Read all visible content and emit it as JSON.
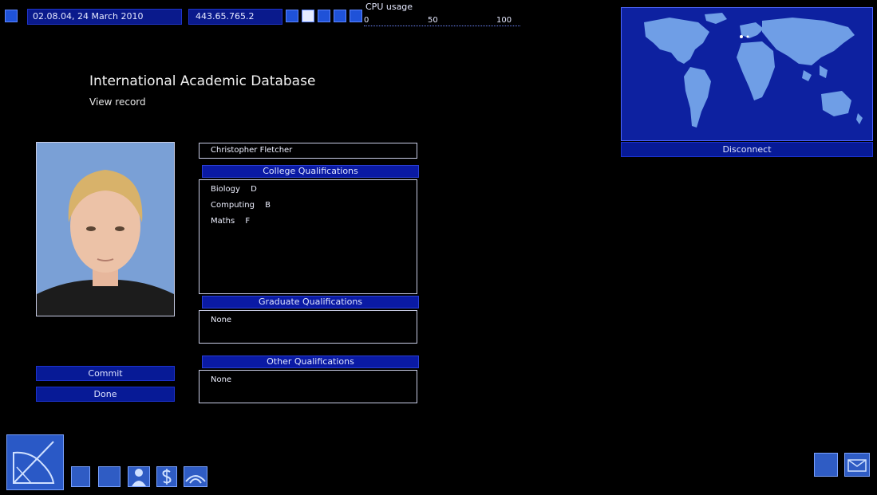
{
  "topbar": {
    "datetime": "02.08.04, 24 March 2010",
    "ip": "443.65.765.2",
    "cpu_label": "CPU usage",
    "cpu_ticks": [
      "0",
      "50",
      "100"
    ]
  },
  "header": {
    "title": "International Academic Database",
    "subtitle": "View record"
  },
  "record": {
    "name": "Christopher Fletcher",
    "college_header": "College Qualifications",
    "college": [
      {
        "subject": "Biology",
        "grade": "D"
      },
      {
        "subject": "Computing",
        "grade": "B"
      },
      {
        "subject": "Maths",
        "grade": "F"
      }
    ],
    "graduate_header": "Graduate Qualifications",
    "graduate": "None",
    "other_header": "Other Qualifications",
    "other": "None"
  },
  "actions": {
    "commit": "Commit",
    "done": "Done"
  },
  "map": {
    "disconnect": "Disconnect"
  },
  "icons": [
    "radar-icon",
    "save-icon",
    "memory-icon",
    "person-icon",
    "finance-icon",
    "network-icon",
    "email-icon",
    "mail-icon"
  ]
}
